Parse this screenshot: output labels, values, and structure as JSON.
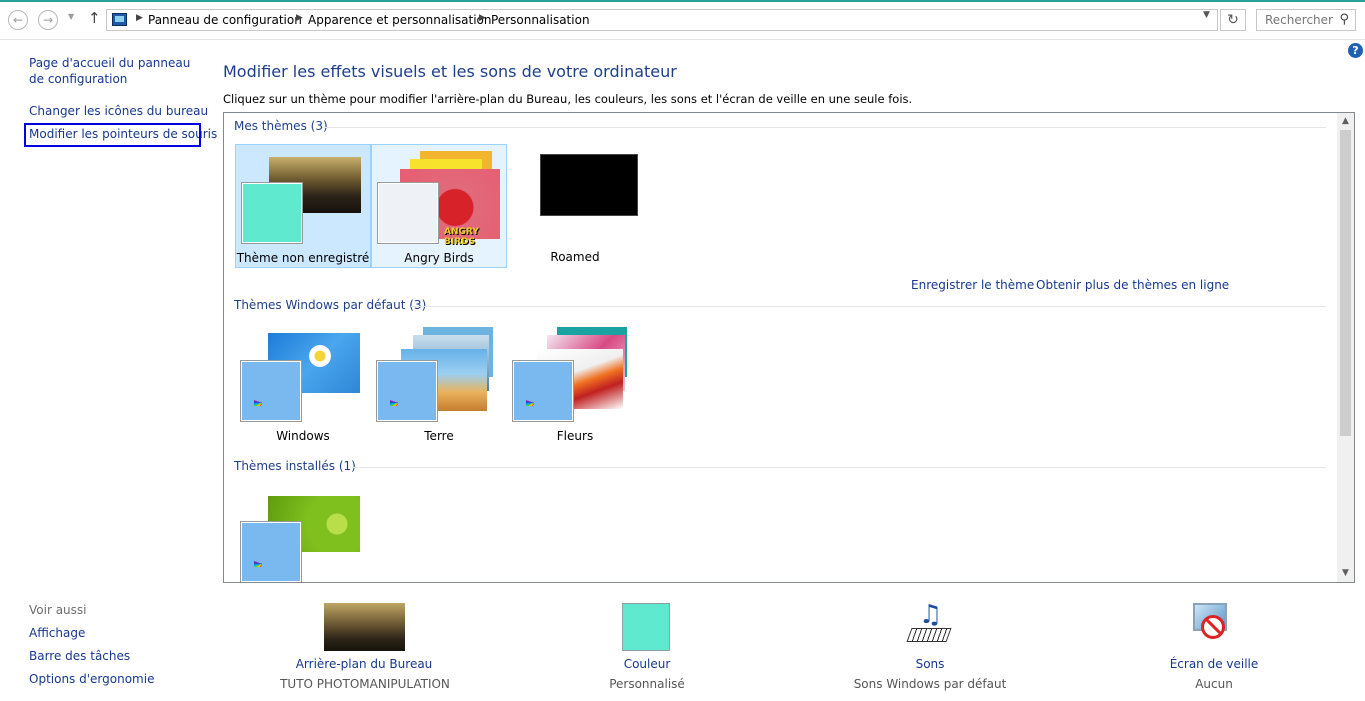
{
  "toolbar": {
    "back_icon": "back-arrow-icon",
    "forward_icon": "forward-arrow-icon",
    "recent_icon": "chevron-down-icon",
    "up_icon": "up-arrow-icon",
    "breadcrumb": [
      "Panneau de configuration",
      "Apparence et personnalisation",
      "Personnalisation"
    ],
    "search_placeholder": "Rechercher"
  },
  "sidebar": {
    "items": [
      {
        "label": "Page d'accueil du panneau de configuration"
      },
      {
        "label": "Changer les icônes du bureau"
      },
      {
        "label": "Modifier les pointeurs de souris"
      }
    ],
    "see_also_title": "Voir aussi",
    "see_also": [
      {
        "label": "Affichage"
      },
      {
        "label": "Barre des tâches"
      },
      {
        "label": "Options d'ergonomie"
      }
    ]
  },
  "main": {
    "title": "Modifier les effets visuels et les sons de votre ordinateur",
    "subtitle": "Cliquez sur un thème pour modifier l'arrière-plan du Bureau, les couleurs, les sons et l'écran de veille en une seule fois.",
    "groups": [
      {
        "title": "Mes thèmes (3)",
        "themes": [
          {
            "name": "Thème non enregistré",
            "state": "selected"
          },
          {
            "name": "Angry Birds",
            "state": "hover"
          },
          {
            "name": "Roamed",
            "state": "normal"
          }
        ]
      },
      {
        "title": "Thèmes Windows par défaut (3)",
        "themes": [
          {
            "name": "Windows"
          },
          {
            "name": "Terre"
          },
          {
            "name": "Fleurs"
          }
        ]
      },
      {
        "title": "Thèmes installés (1)",
        "themes": [
          {
            "name": ""
          }
        ]
      }
    ],
    "save_theme_link": "Enregistrer le thème",
    "more_themes_link": "Obtenir plus de thèmes en ligne",
    "angry_birds_logo": "ANGRY BIRDS"
  },
  "bottom": [
    {
      "label": "Arrière-plan du Bureau",
      "value": "TUTO PHOTOMANIPULATION",
      "icon": "wallpaper-icon"
    },
    {
      "label": "Couleur",
      "value": "Personnalisé",
      "icon": "color-swatch-icon"
    },
    {
      "label": "Sons",
      "value": "Sons Windows par défaut",
      "icon": "sounds-icon"
    },
    {
      "label": "Écran de veille",
      "value": "Aucun",
      "icon": "screensaver-icon"
    }
  ],
  "colors": {
    "link": "#16388e",
    "selected_tile": "#cce8ff",
    "accent_swatch": "#5fe9cf"
  }
}
